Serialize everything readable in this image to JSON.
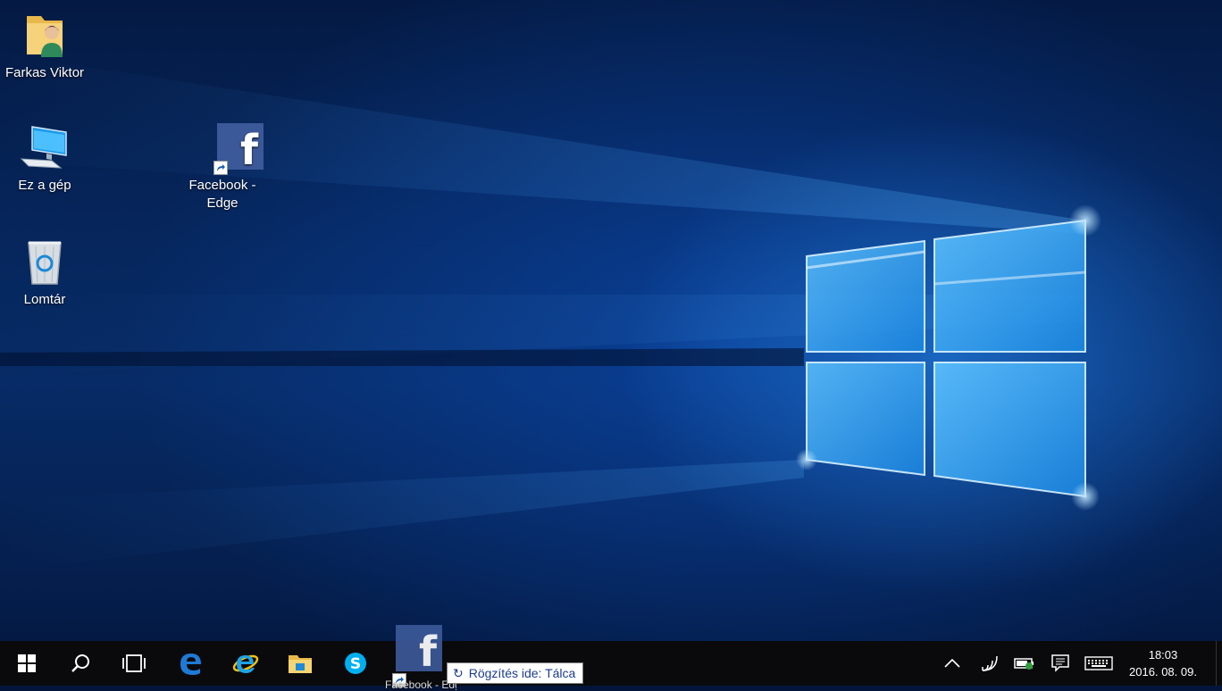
{
  "desktop": {
    "icons": [
      {
        "label": "Farkas Viktor",
        "icon": "user-folder-icon"
      },
      {
        "label": "Ez a gép",
        "icon": "this-pc-icon"
      },
      {
        "label": "Lomtár",
        "icon": "recycle-bin-icon"
      },
      {
        "label": "Facebook - Edge",
        "icon": "facebook-shortcut-icon"
      }
    ]
  },
  "taskbar": {
    "pinned": [
      {
        "name": "start",
        "icon": "windows-logo-icon"
      },
      {
        "name": "search",
        "icon": "search-icon"
      },
      {
        "name": "task-view",
        "icon": "task-view-icon"
      },
      {
        "name": "edge",
        "icon": "edge-icon"
      },
      {
        "name": "internet-explorer",
        "icon": "internet-explorer-icon"
      },
      {
        "name": "file-explorer",
        "icon": "file-explorer-icon"
      },
      {
        "name": "skype",
        "icon": "skype-icon"
      }
    ],
    "drag_item": {
      "label": "Facebook - Edge",
      "icon": "facebook-icon"
    },
    "drop_tooltip": "Rögzítés ide: Tálca",
    "tray": {
      "icons": [
        "chevron-up-icon",
        "wifi-icon",
        "battery-icon",
        "action-center-icon",
        "keyboard-icon"
      ],
      "time": "18:03",
      "date": "2016. 08. 09."
    }
  },
  "colors": {
    "taskbar": "#0a0a0d",
    "facebook": "#3b5998",
    "edge": "#1e7ad6",
    "ie": "#1fa2e6",
    "skype": "#00aff0",
    "tooltip_text": "#1b3c8f"
  }
}
